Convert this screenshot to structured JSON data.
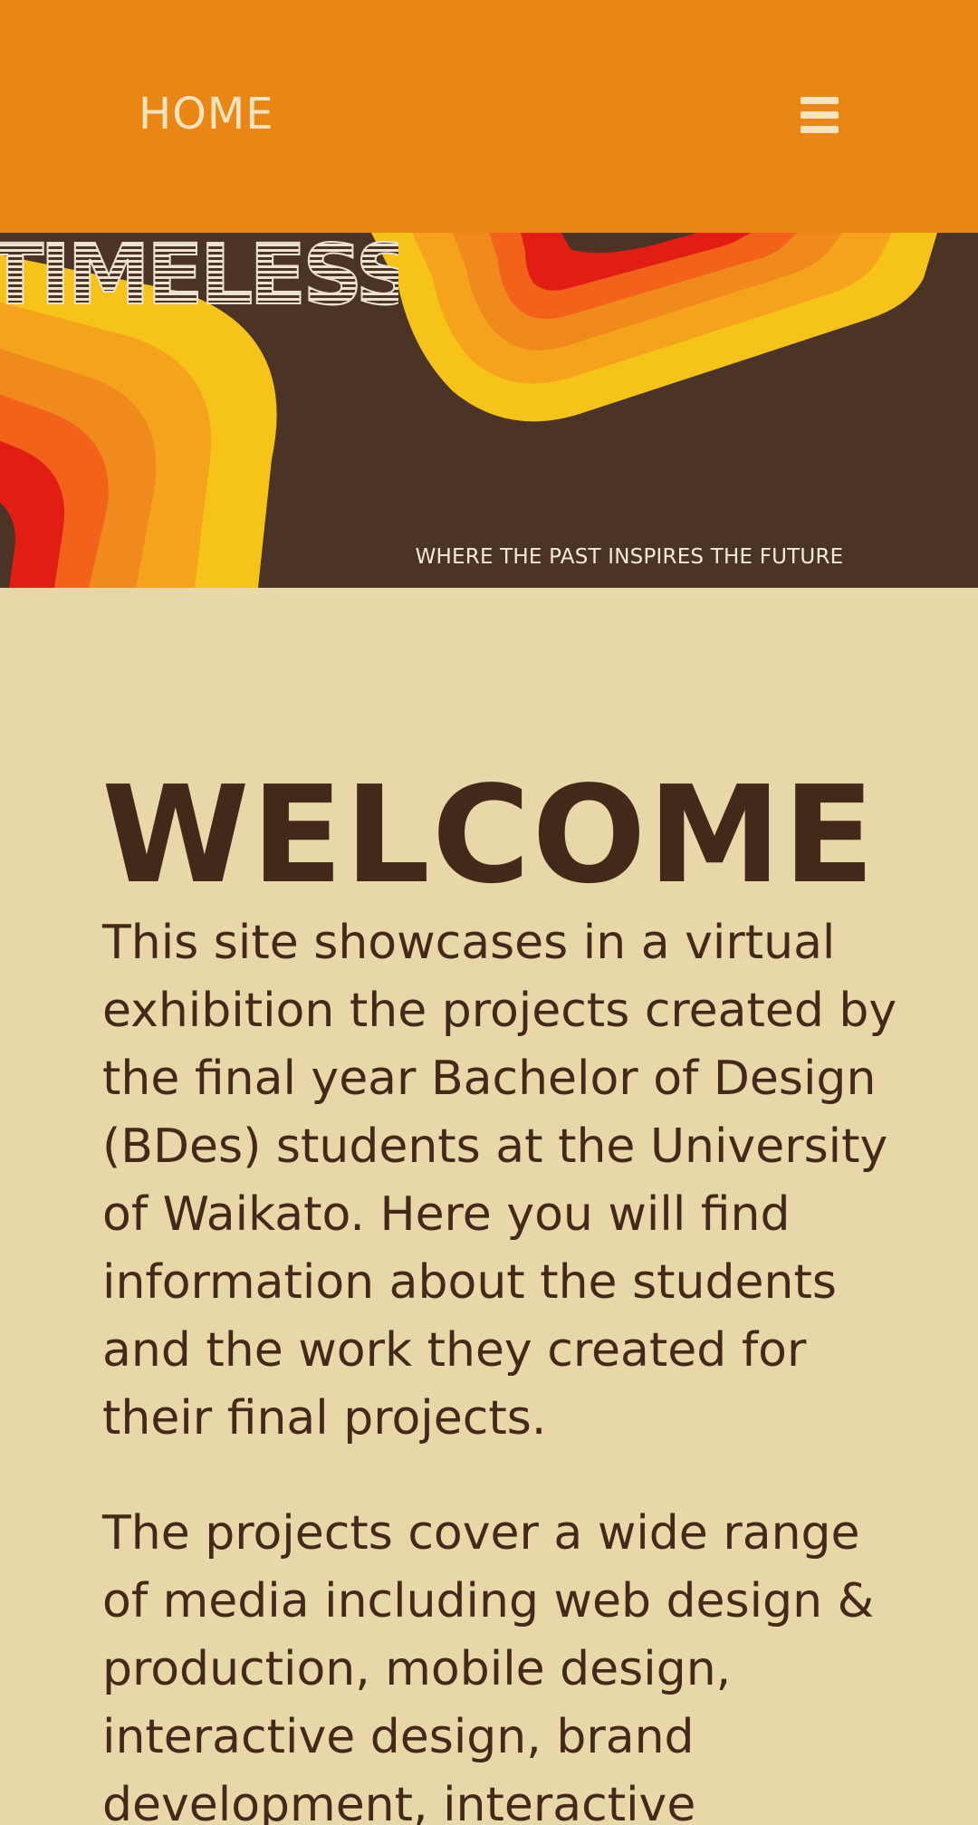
{
  "header": {
    "home_label": "HOME",
    "menu_icon": "hamburger-menu-icon"
  },
  "banner": {
    "brand_name": "TIMELESS",
    "tagline": "WHERE THE PAST INSPIRES THE FUTURE",
    "colors": {
      "background": "#4b3326",
      "yellow": "#f6c318",
      "light_orange": "#f5a31c",
      "orange": "#f08a1c",
      "dark_orange": "#f2621a",
      "red": "#e11d14"
    }
  },
  "main": {
    "heading": "WELCOME",
    "paragraphs": [
      "This site showcases in a virtual exhibition the projects created by the final year Bachelor of Design (BDes) students at the University of Waikato. Here you will find information about the students and the work they created for their final projects.",
      "The projects cover a wide range of media including web design & production, mobile design, interactive design, brand development, interactive"
    ]
  },
  "colors": {
    "header_bg": "#ea8614",
    "page_bg": "#e8d7a9",
    "text": "#42291a",
    "header_text": "#f7e3bf"
  }
}
